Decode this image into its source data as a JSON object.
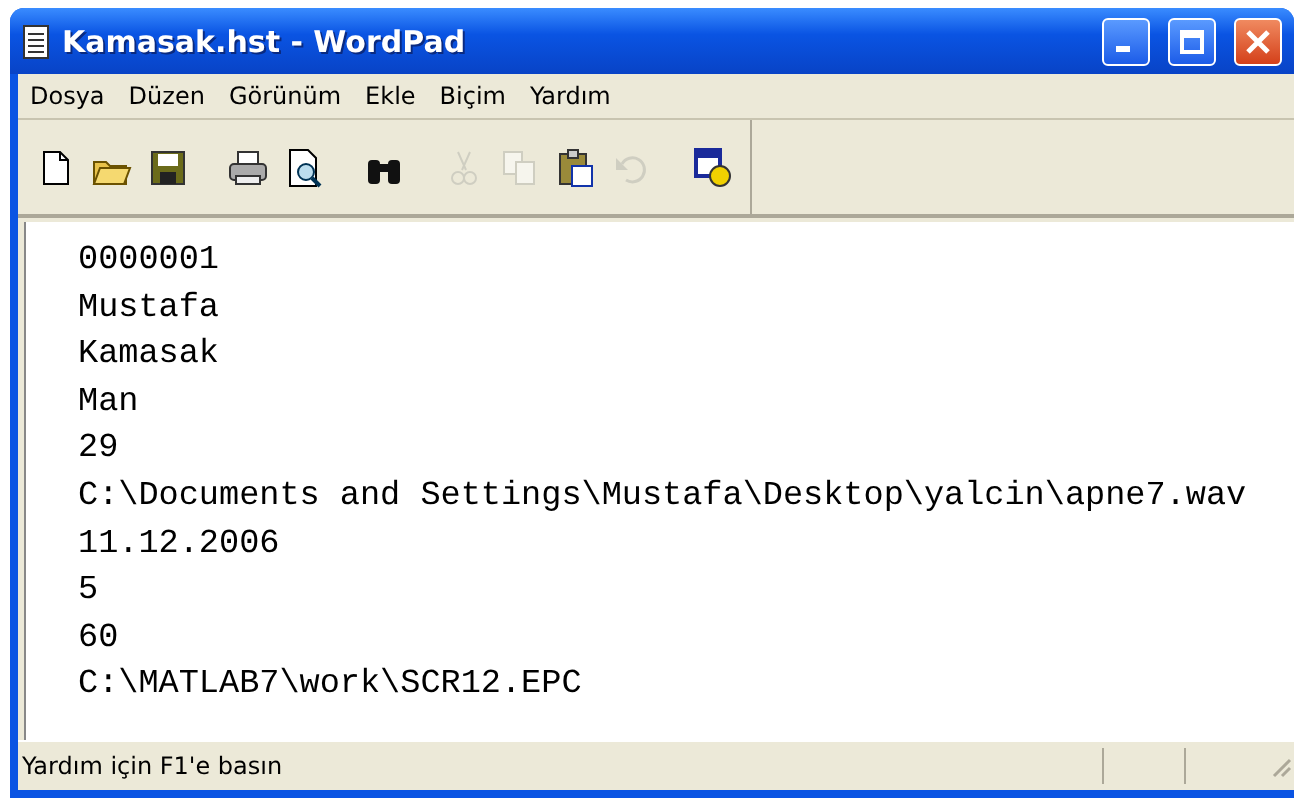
{
  "window": {
    "title": "Kamasak.hst - WordPad"
  },
  "menu": [
    "Dosya",
    "Düzen",
    "Görünüm",
    "Ekle",
    "Biçim",
    "Yardım"
  ],
  "toolbar": [
    {
      "kind": "new",
      "disabled": false
    },
    {
      "kind": "open",
      "disabled": false
    },
    {
      "kind": "save",
      "disabled": false
    },
    {
      "kind": "sep"
    },
    {
      "kind": "print",
      "disabled": false
    },
    {
      "kind": "preview",
      "disabled": false
    },
    {
      "kind": "sep"
    },
    {
      "kind": "find",
      "disabled": false
    },
    {
      "kind": "sep"
    },
    {
      "kind": "cut",
      "disabled": true
    },
    {
      "kind": "copy",
      "disabled": true
    },
    {
      "kind": "paste",
      "disabled": false
    },
    {
      "kind": "undo",
      "disabled": true
    },
    {
      "kind": "sep"
    },
    {
      "kind": "datetime",
      "disabled": false
    }
  ],
  "document": {
    "lines": [
      "0000001",
      "Mustafa",
      "Kamasak",
      "Man",
      "29",
      "C:\\Documents and Settings\\Mustafa\\Desktop\\yalcin\\apne7.wav",
      "11.12.2006",
      "5",
      "60",
      "C:\\MATLAB7\\work\\SCR12.EPC"
    ]
  },
  "status_bar": {
    "text": "Yardım için F1'e basın"
  }
}
